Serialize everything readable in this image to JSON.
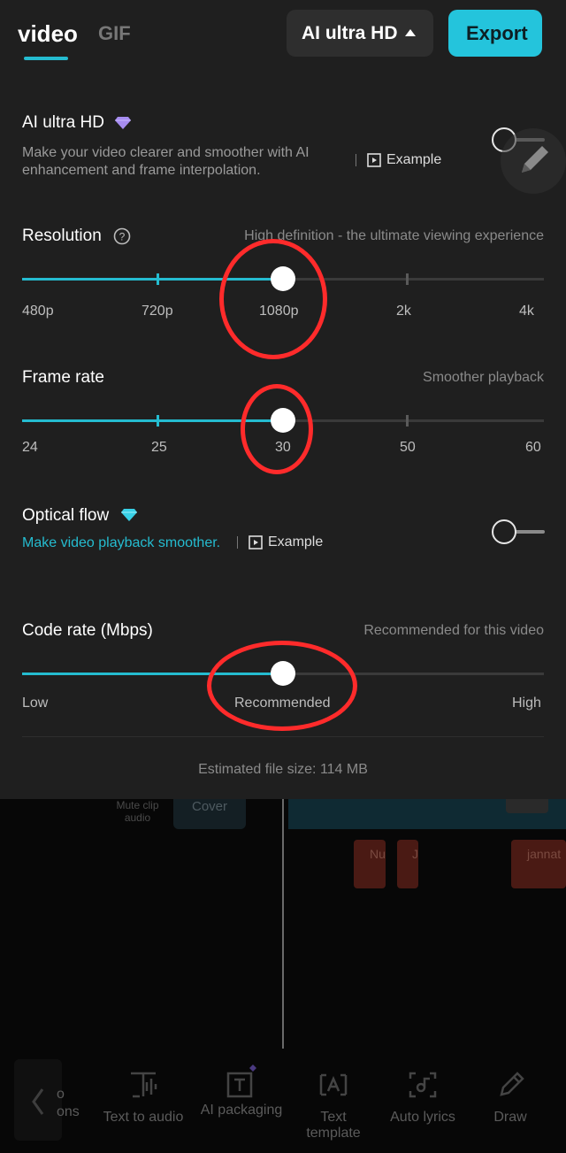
{
  "header": {
    "tab_video": "video",
    "tab_gif": "GIF",
    "quality_dropdown": "AI ultra HD",
    "export_label": "Export"
  },
  "ai_ultra_hd": {
    "title": "AI ultra HD",
    "desc_line1": "Make your video clearer and smoother with AI",
    "desc_line2": "enhancement and frame interpolation.",
    "example_label": "Example",
    "enabled": false
  },
  "resolution": {
    "title": "Resolution",
    "hint": "High definition - the ultimate viewing experience",
    "options": [
      "480p",
      "720p",
      "1080p",
      "2k",
      "4k"
    ],
    "selected": "1080p"
  },
  "frame_rate": {
    "title": "Frame rate",
    "hint": "Smoother playback",
    "options": [
      "24",
      "25",
      "30",
      "50",
      "60"
    ],
    "selected": "30"
  },
  "optical_flow": {
    "title": "Optical flow",
    "desc": "Make video playback smoother.",
    "example_label": "Example",
    "enabled": false
  },
  "code_rate": {
    "title": "Code rate (Mbps)",
    "hint": "Recommended for this video",
    "low": "Low",
    "recommended": "Recommended",
    "high": "High",
    "selected": "Recommended"
  },
  "estimated_size": "Estimated file size: 114 MB",
  "timeline": {
    "mute_line1": "Mute clip",
    "mute_line2": "audio",
    "cover": "Cover",
    "clip1": "Nu",
    "clip2": "J",
    "clip3": "jannat"
  },
  "toolbar": {
    "partial_top": "o",
    "partial_bottom": "ons",
    "text_to_audio": "Text to audio",
    "ai_packaging": "AI packaging",
    "text_template_1": "Text",
    "text_template_2": "template",
    "auto_lyrics": "Auto lyrics",
    "draw": "Draw"
  },
  "colors": {
    "accent": "#25bcd0",
    "panel": "#1f1f1f",
    "annotation": "#ff2b2b"
  }
}
